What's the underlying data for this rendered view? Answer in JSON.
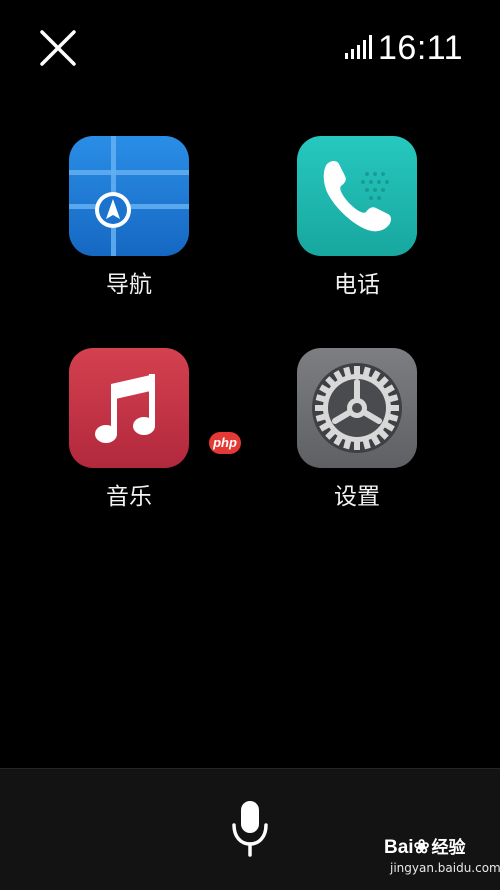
{
  "status_bar": {
    "time": "16:11",
    "signal_icon": "signal-bars-icon",
    "close_icon": "close-icon"
  },
  "apps": [
    {
      "label": "导航",
      "icon": "navigation-icon",
      "color": "#1e7fd6"
    },
    {
      "label": "电话",
      "icon": "phone-icon",
      "color": "#1fb9b0"
    },
    {
      "label": "音乐",
      "icon": "music-note-icon",
      "color": "#c8344a"
    },
    {
      "label": "设置",
      "icon": "gear-icon",
      "color": "#6e6f73"
    }
  ],
  "badge": {
    "text": "php",
    "color": "#e53935"
  },
  "bottom_bar": {
    "mic_icon": "microphone-icon"
  },
  "watermark": {
    "brand_latin": "Bai",
    "brand_cn": "经验",
    "url": "jingyan.baidu.com"
  }
}
